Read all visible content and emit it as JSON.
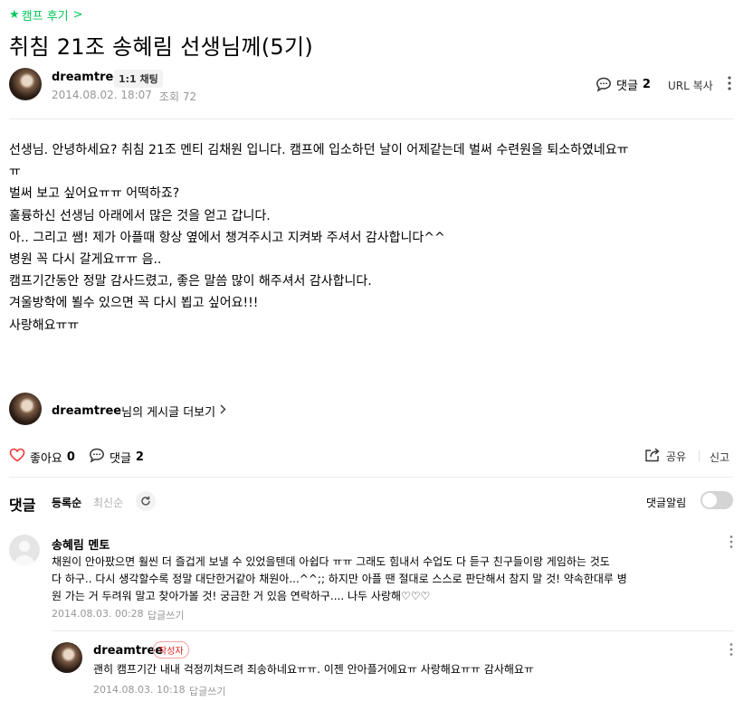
{
  "breadcrumb": {
    "star": "★",
    "label": "캠프 후기",
    "chevron": ">"
  },
  "post": {
    "title": "취침 21조 송혜림 선생님께(5기)",
    "author": "dreamtree",
    "chat_badge": "1:1 채팅",
    "date": "2014.08.02. 18:07",
    "views": "조회 72",
    "comment_label": "댓글",
    "comment_count": "2",
    "url_copy": "URL 복사",
    "body_lines": [
      "선생님. 안녕하세요?  취침 21조 멘티 김채원 입니다. 캠프에 입소하던 날이 어제같는데 벌써 수련원을 퇴소하였네요ㅠ",
      "ㅠ",
      "벌써 보고 싶어요ㅠㅠ 어떡하죠?",
      "훌륭하신 선생님 아래에서 많은 것을 얻고 갑니다.",
      "아.. 그리고 쌤! 제가 아플때 항상 옆에서 챙겨주시고 지켜봐 주셔서 감사합니다^^",
      "병원 꼭 다시 갈게요ㅠㅠ 음..",
      "캠프기간동안 정말 감사드렸고, 좋은 말씀 많이 해주셔서 감사합니다.",
      "겨울방학에 뵐수 있으면 꼭 다시 뵙고 싶어요!!!",
      "사랑해요ㅠㅠ"
    ],
    "more_posts_suffix": "님의 게시글 더보기",
    "like_label": "좋아요",
    "like_count": "0",
    "share": "공유",
    "report": "신고"
  },
  "comments_section": {
    "title": "댓글",
    "sort_registered": "등록순",
    "sort_latest": "최신순",
    "alarm_label": "댓글알림",
    "alarm_on": false
  },
  "comments": [
    {
      "author": "송혜림 멘토",
      "lines": [
        "채원이 안아팠으면 훨씬 더 즐겁게 보낼 수 있었을텐데 아쉽다 ㅠㅠ 그래도 힘내서 수업도 다 듣구 친구들이랑 게임하는 것도",
        "다 하구.. 다시 생각할수록 정말 대단한거같아 채원아...^^;; 하지만 아플 땐 절대로 스스로 판단해서 참지 말 것! 약속한대루 병",
        "원 가는 거 두려워 말고 찾아가볼 것! 궁금한 거 있음 연락하구.... 나두 사랑해♡♡♡"
      ],
      "date": "2014.08.03. 00:28",
      "reply": "답글쓰기"
    },
    {
      "author": "dreamtree",
      "badge": "작성자",
      "lines": [
        "괜히 캠프기간 내내 걱정끼쳐드려 죄송하네요ㅠㅠ. 이젠 안아플거에요ㅠ 사랑해요ㅠㅠ 감사해요ㅠ"
      ],
      "date": "2014.08.03. 10:18",
      "reply": "답글쓰기"
    }
  ],
  "colors": {
    "accent": "#03c75a",
    "badge_red": "#e02020",
    "muted": "#979797"
  }
}
